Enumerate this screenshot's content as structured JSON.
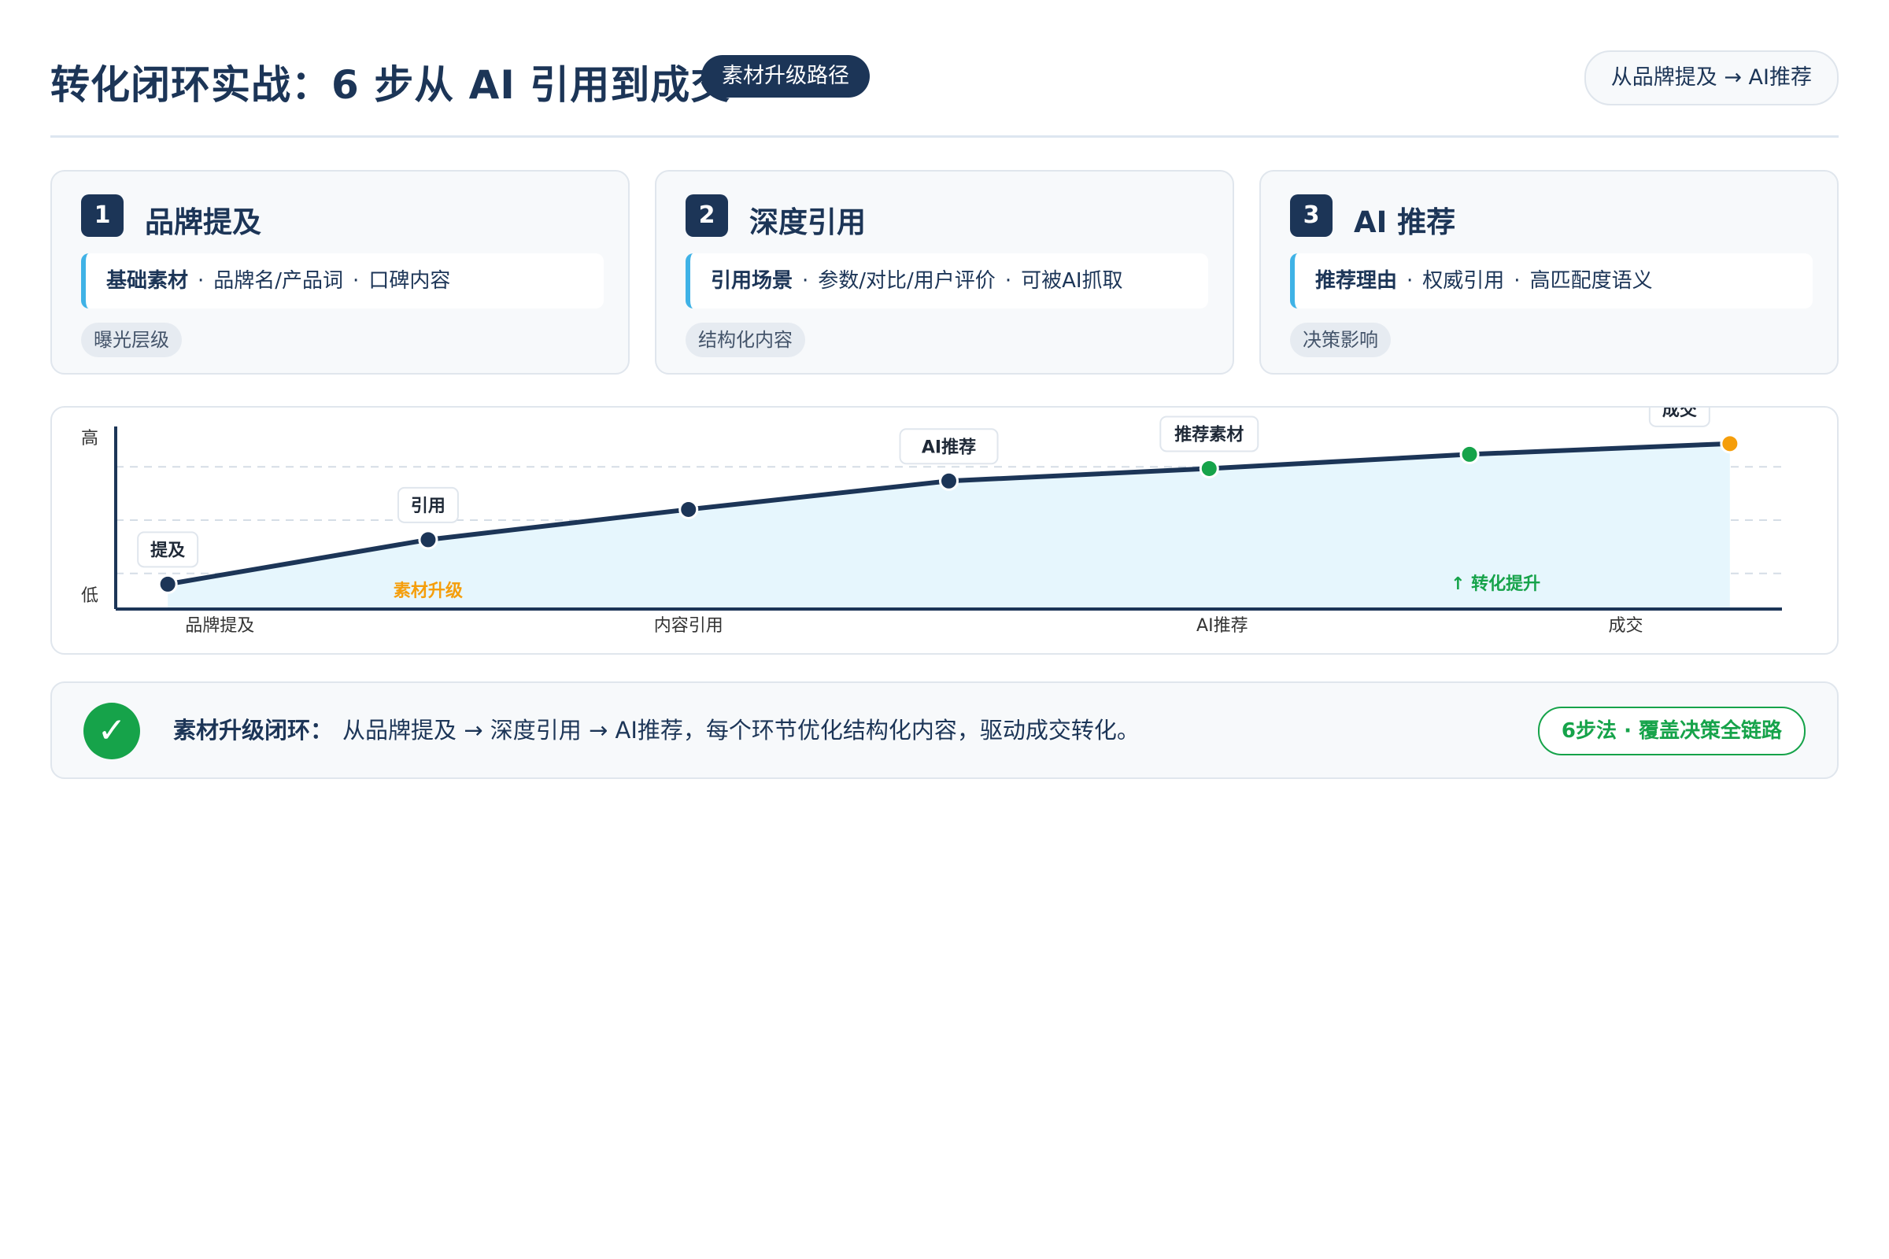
{
  "header": {
    "title": "转化闭环实战：6 步从 AI 引用到成交",
    "badge": "素材升级路径",
    "flow_pill": "从品牌提及 → AI推荐"
  },
  "cards": [
    {
      "num": "1",
      "title": "品牌提及",
      "label": "基础素材",
      "items": [
        "品牌名/产品词",
        "口碑内容"
      ],
      "tag": "曝光层级"
    },
    {
      "num": "2",
      "title": "深度引用",
      "label": "引用场景",
      "items": [
        "参数/对比/用户评价",
        "可被AI抓取"
      ],
      "tag": "结构化内容"
    },
    {
      "num": "3",
      "title": "AI 推荐",
      "label": "推荐理由",
      "items": [
        "权威引用",
        "高匹配度语义"
      ],
      "tag": "决策影响"
    }
  ],
  "separator": "·",
  "chart_data": {
    "type": "line",
    "y_axis": {
      "high_label": "高",
      "low_label": "低",
      "ylim": [
        0,
        100
      ]
    },
    "x_ticks": [
      {
        "x": 0.2,
        "label": "品牌提及"
      },
      {
        "x": 2.0,
        "label": "内容引用"
      },
      {
        "x": 4.05,
        "label": "AI推荐"
      },
      {
        "x": 5.6,
        "label": "成交"
      }
    ],
    "xlim": [
      -0.2,
      6.2
    ],
    "grid": true,
    "points": [
      {
        "x": 0,
        "y": 14,
        "label": "提及",
        "color": "#1c3557"
      },
      {
        "x": 1,
        "y": 39,
        "label": "引用",
        "color": "#1c3557"
      },
      {
        "x": 2,
        "y": 56,
        "label": "",
        "color": "#1c3557"
      },
      {
        "x": 3,
        "y": 72,
        "label": "AI推荐",
        "color": "#1c3557"
      },
      {
        "x": 4,
        "y": 79,
        "label": "推荐素材",
        "color": "#16a34a"
      },
      {
        "x": 5,
        "y": 87,
        "label": "",
        "color": "#16a34a"
      },
      {
        "x": 6,
        "y": 93,
        "label": "成交",
        "color": "#f59e0b"
      }
    ],
    "annotations": [
      {
        "text": "素材升级",
        "x": 1.0,
        "y": 7,
        "color": "#f59e0b"
      },
      {
        "text": "↑ 转化提升",
        "x": 5.1,
        "y": 11,
        "color": "#16a34a"
      }
    ],
    "colors": {
      "line": "#1c3557",
      "fill": "#e6f6fd",
      "axis": "#1c3557",
      "grid": "#d5dde6"
    }
  },
  "summary": {
    "lead": "素材升级闭环：",
    "text": "从品牌提及 → 深度引用 → AI推荐，每个环节优化结构化内容，驱动成交转化。",
    "pill": "6步法 · 覆盖决策全链路",
    "check_icon": "✓"
  }
}
